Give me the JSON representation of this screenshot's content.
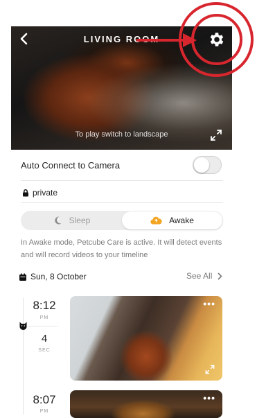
{
  "header": {
    "title": "LIVING ROOM"
  },
  "camera": {
    "hint": "To play switch to landscape"
  },
  "auto_connect": {
    "label": "Auto Connect to Camera",
    "enabled": false
  },
  "privacy": {
    "label": "private"
  },
  "mode": {
    "options": [
      {
        "label": "Sleep",
        "icon": "moon-icon",
        "selected": false
      },
      {
        "label": "Awake",
        "icon": "cloud-icon",
        "selected": true
      }
    ],
    "description": "In Awake mode, Petcube Care is active. It will detect events and will record videos to your timeline"
  },
  "timeline": {
    "date": "Sun, 8 October",
    "see_all": "See All",
    "events": [
      {
        "time": "8:12",
        "period": "PM",
        "duration": "4",
        "duration_unit": "SEC"
      },
      {
        "time": "8:07",
        "period": "PM"
      }
    ]
  },
  "colors": {
    "accent": "#f2a623",
    "annotation": "#d8262e",
    "toggle_off": "#ececec"
  }
}
